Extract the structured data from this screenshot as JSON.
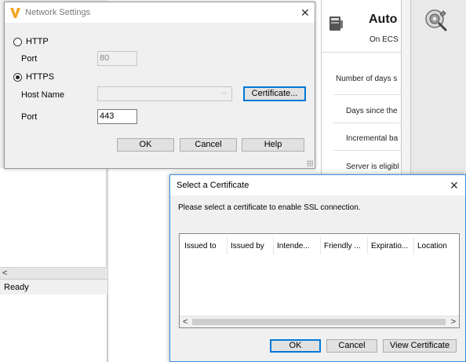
{
  "network_dialog": {
    "title": "Network Settings",
    "http_label": "HTTP",
    "http_port_label": "Port",
    "http_port_value": "80",
    "https_label": "HTTPS",
    "host_name_label": "Host Name",
    "host_name_value": "",
    "certificate_button": "Certificate...",
    "https_port_label": "Port",
    "https_port_value": "443",
    "ok_button": "OK",
    "cancel_button": "Cancel",
    "help_button": "Help",
    "selected_protocol": "HTTPS"
  },
  "certificate_dialog": {
    "title": "Select a Certificate",
    "message": "Please select a certificate to enable SSL connection.",
    "columns": [
      "Issued to",
      "Issued by",
      "Intende...",
      "Friendly ...",
      "Expiratio...",
      "Location"
    ],
    "ok_button": "OK",
    "cancel_button": "Cancel",
    "view_button": "View Certificate"
  },
  "background_app": {
    "panel_title": "Auto",
    "panel_subtitle": "On ECS",
    "rows": [
      "Number of days s",
      "Days since the",
      "Incremental ba",
      "Server is eligibl"
    ],
    "status_text": "Ready",
    "accent_color": "#0078d7",
    "logo_color": "#f5a623"
  }
}
